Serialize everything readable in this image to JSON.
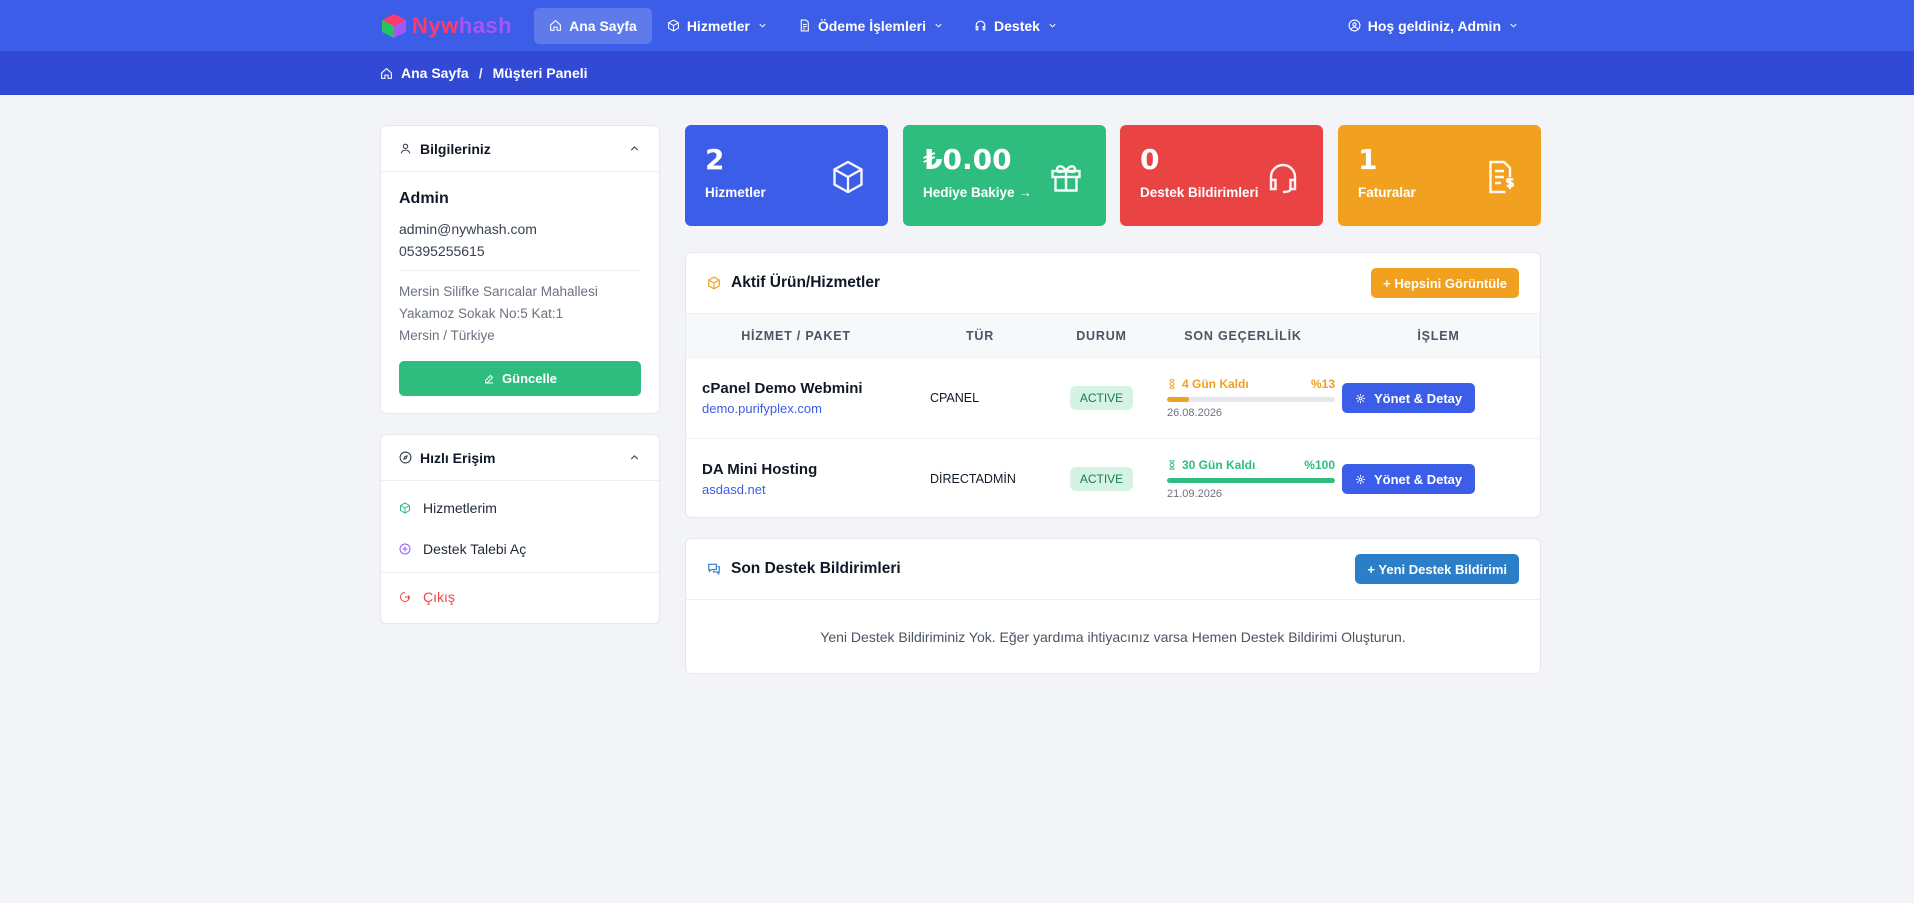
{
  "brand": {
    "logo_text_a": "Nyw",
    "logo_text_b": "hash"
  },
  "nav": {
    "items": [
      {
        "label": "Ana Sayfa",
        "icon": "home-icon"
      },
      {
        "label": "Hizmetler",
        "icon": "box-icon"
      },
      {
        "label": "Ödeme İşlemleri",
        "icon": "receipt-icon"
      },
      {
        "label": "Destek",
        "icon": "headset-icon"
      }
    ],
    "user_label": "Hoş geldiniz, Admin"
  },
  "breadcrumb": {
    "home": "Ana Sayfa",
    "separator": "/",
    "current": "Müşteri Paneli"
  },
  "profile": {
    "title": "Bilgileriniz",
    "name": "Admin",
    "email": "admin@nywhash.com",
    "phone": "05395255615",
    "address_line1": "Mersin Silifke Sarıcalar Mahallesi",
    "address_line2": "Yakamoz Sokak No:5 Kat:1",
    "address_line3": "Mersin / Türkiye",
    "update_button": "Güncelle"
  },
  "quick_access": {
    "title": "Hızlı Erişim",
    "items": [
      "Hizmetlerim",
      "Destek Talebi Aç"
    ],
    "logout": "Çıkış"
  },
  "stats": [
    {
      "value": "2",
      "label": "Hizmetler",
      "color": "#3b5de7",
      "icon": "cube-icon"
    },
    {
      "value": "₺0.00",
      "label": "Hediye Bakiye →",
      "color": "#2ebd7f",
      "icon": "gift-icon"
    },
    {
      "value": "0",
      "label": "Destek Bildirimleri",
      "color": "#ea4343",
      "icon": "headset-icon"
    },
    {
      "value": "1",
      "label": "Faturalar",
      "color": "#f1a01f",
      "icon": "invoice-icon"
    }
  ],
  "services": {
    "title": "Aktif Ürün/Hizmetler",
    "view_all": "+ Hepsini Görüntüle",
    "columns": [
      "HİZMET / PAKET",
      "TÜR",
      "DURUM",
      "SON GEÇERLİLİK",
      "İŞLEM"
    ],
    "rows": [
      {
        "name": "cPanel Demo Webmini",
        "domain": "demo.purifyplex.com",
        "type": "CPANEL",
        "status": "ACTIVE",
        "remaining": "4 Gün Kaldı",
        "percent_label": "%13",
        "percent": 13,
        "color": "#f1a01f",
        "date": "26.08.2026",
        "action": "Yönet & Detay"
      },
      {
        "name": "DA Mini Hosting",
        "domain": "asdasd.net",
        "type": "DİRECTADMİN",
        "status": "ACTIVE",
        "remaining": "30 Gün Kaldı",
        "percent_label": "%100",
        "percent": 100,
        "color": "#2ebd7f",
        "date": "21.09.2026",
        "action": "Yönet & Detay"
      }
    ]
  },
  "tickets": {
    "title": "Son Destek Bildirimleri",
    "new_button": "+ Yeni Destek Bildirimi",
    "empty_text": "Yeni Destek Bildiriminiz Yok. Eğer yardıma ihtiyacınız varsa Hemen Destek Bildirimi Oluşturun."
  }
}
